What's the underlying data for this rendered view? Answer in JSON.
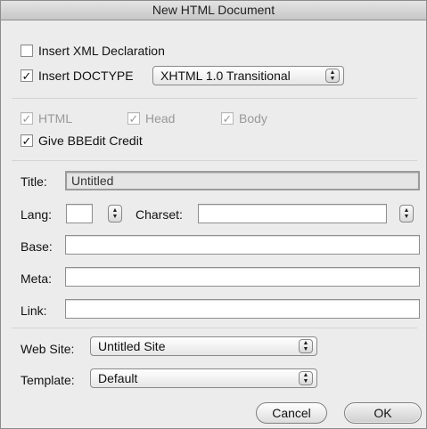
{
  "window": {
    "title": "New HTML Document"
  },
  "options": {
    "insert_xml_declaration": {
      "label": "Insert XML Declaration",
      "checked": false
    },
    "insert_doctype": {
      "label": "Insert DOCTYPE",
      "checked": true
    },
    "doctype_select": {
      "value": "XHTML 1.0 Transitional"
    },
    "html": {
      "label": "HTML",
      "checked": true,
      "enabled": false
    },
    "head": {
      "label": "Head",
      "checked": true,
      "enabled": false
    },
    "body": {
      "label": "Body",
      "checked": true,
      "enabled": false
    },
    "give_bbedit_credit": {
      "label": "Give BBEdit Credit",
      "checked": true
    }
  },
  "fields": {
    "title_label": "Title:",
    "title_value": "Untitled",
    "lang_label": "Lang:",
    "lang_value": "",
    "charset_label": "Charset:",
    "charset_value": "",
    "base_label": "Base:",
    "base_value": "",
    "meta_label": "Meta:",
    "meta_value": "",
    "link_label": "Link:",
    "link_value": ""
  },
  "site": {
    "web_site_label": "Web Site:",
    "web_site_value": "Untitled Site",
    "template_label": "Template:",
    "template_value": "Default"
  },
  "actions": {
    "cancel_label": "Cancel",
    "ok_label": "OK"
  },
  "icons": {
    "checkmark": "checkmark-icon",
    "select_arrows": "updown-arrows-icon"
  }
}
